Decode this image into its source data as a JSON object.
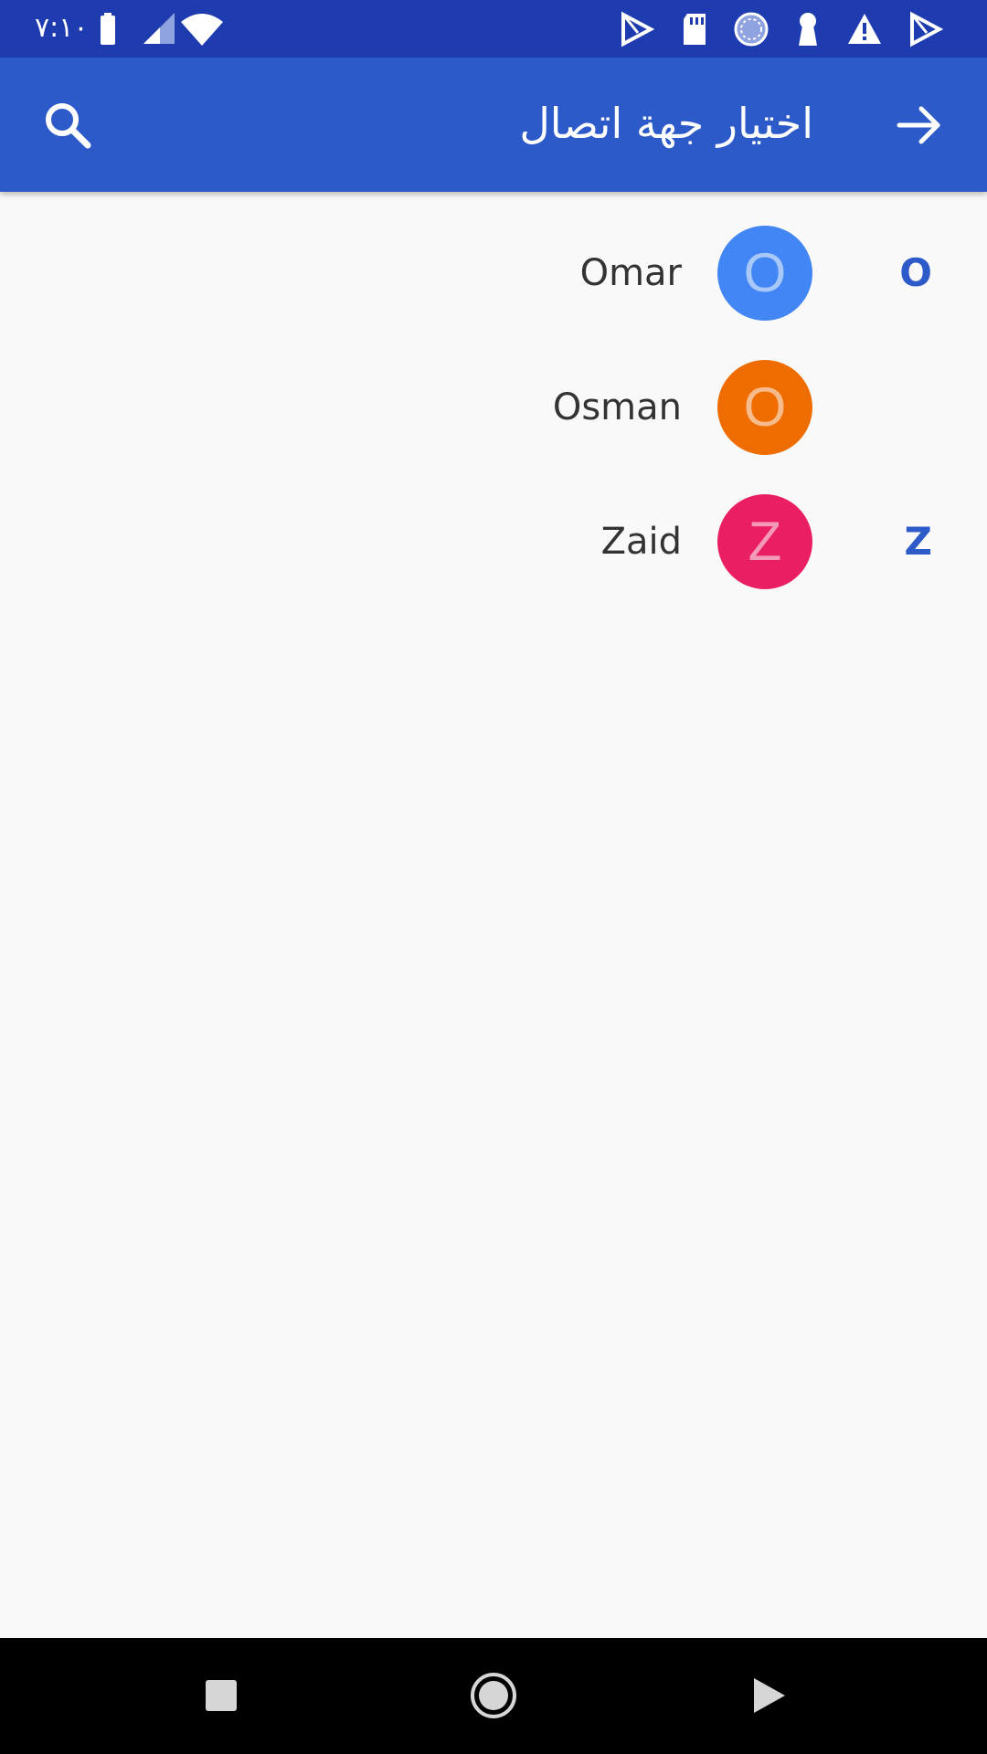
{
  "status_bar": {
    "time": "٧:١٠",
    "icons": [
      "battery-icon",
      "signal-icon",
      "wifi-icon",
      "play-store-icon",
      "sd-card-icon",
      "sync-icon",
      "keyhole-icon",
      "warning-icon",
      "play-store-icon"
    ]
  },
  "app_bar": {
    "title": "اختيار جهة اتصال",
    "search_icon": "search-icon",
    "back_icon": "arrow-forward-icon"
  },
  "contacts": [
    {
      "section": "O",
      "initial": "O",
      "name": "Omar",
      "color": "#4285f4"
    },
    {
      "section": "",
      "initial": "O",
      "name": "Osman",
      "color": "#ef6c00"
    },
    {
      "section": "Z",
      "initial": "Z",
      "name": "Zaid",
      "color": "#e91e63"
    }
  ],
  "nav_bar": {
    "items": [
      "recents-icon",
      "home-icon",
      "back-icon"
    ]
  }
}
